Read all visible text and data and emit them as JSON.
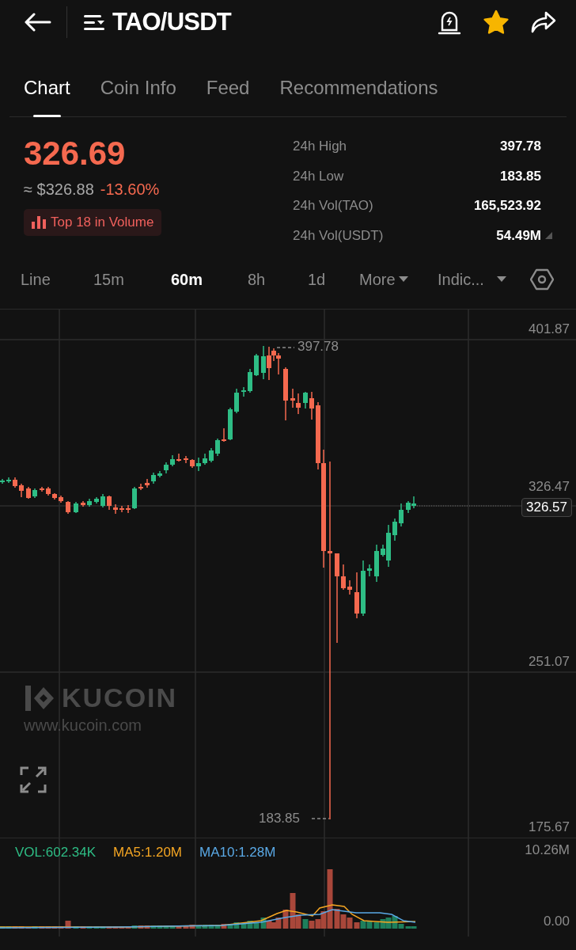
{
  "header": {
    "title": "TAO/USDT",
    "favorite": true
  },
  "tabs": [
    {
      "label": "Chart",
      "selected": true
    },
    {
      "label": "Coin Info",
      "selected": false
    },
    {
      "label": "Feed",
      "selected": false
    },
    {
      "label": "Recommendations",
      "selected": false
    }
  ],
  "ticker": {
    "price": "326.69",
    "usd_price": "≈ $326.88",
    "change": "-13.60%",
    "badge": "Top 18 in Volume"
  },
  "stats": [
    {
      "label": "24h High",
      "value": "397.78"
    },
    {
      "label": "24h Low",
      "value": "183.85"
    },
    {
      "label": "24h Vol(TAO)",
      "value": "165,523.92"
    },
    {
      "label": "24h Vol(USDT)",
      "value": "54.49M"
    }
  ],
  "intervals": [
    {
      "label": "Line",
      "kind": "option",
      "selected": false
    },
    {
      "label": "15m",
      "kind": "option",
      "selected": false
    },
    {
      "label": "60m",
      "kind": "option",
      "selected": true
    },
    {
      "label": "8h",
      "kind": "option",
      "selected": false
    },
    {
      "label": "1d",
      "kind": "option",
      "selected": false
    },
    {
      "label": "More",
      "kind": "dropdown",
      "selected": false
    },
    {
      "label": "Indic...",
      "kind": "dropdown",
      "selected": false
    }
  ],
  "chart": {
    "price_axis": [
      "401.87",
      "326.47",
      "251.07",
      "175.67"
    ],
    "high_marker": "397.78",
    "low_marker": "183.85",
    "last_price": "326.57",
    "watermark_brand": "KUCOIN",
    "watermark_url": "www.kucoin.com"
  },
  "volume": {
    "legend": [
      {
        "label": "VOL:602.34K",
        "color": "#2ebd85"
      },
      {
        "label": "MA5:1.20M",
        "color": "#f5a623"
      },
      {
        "label": "MA10:1.28M",
        "color": "#5aa9e6"
      }
    ],
    "axis": [
      "10.26M",
      "0.00"
    ]
  }
}
